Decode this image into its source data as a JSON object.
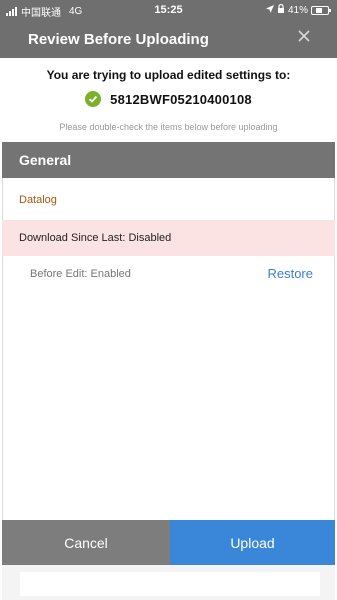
{
  "status_bar": {
    "carrier": "中国联通",
    "network": "4G",
    "time": "15:25",
    "battery": "41%",
    "battery_level": 0.41,
    "icons": [
      "signal-icon",
      "location-arrow-icon",
      "lock-rotation-icon",
      "battery-icon"
    ]
  },
  "header": {
    "title": "Review Before Uploading",
    "close_icon": "close-icon"
  },
  "info": {
    "title": "You are trying to upload edited settings to:",
    "device_id": "5812BWF05210400108",
    "device_status_icon": "check-circle-icon",
    "hint": "Please double-check the items below before uploading"
  },
  "section": {
    "title": "General",
    "group": "Datalog",
    "change": "Download Since Last: Disabled",
    "before": "Before Edit: Enabled",
    "restore_label": "Restore"
  },
  "actions": {
    "cancel_label": "Cancel",
    "upload_label": "Upload"
  },
  "colors": {
    "header_bg": "#6f6f6f",
    "section_bg": "#747474",
    "group_label": "#a4580e",
    "change_row_bg": "#fbe3e3",
    "restore_link": "#3a7fd5",
    "cancel_bg": "#7d7d7d",
    "upload_bg": "#3a86d9",
    "check": "#7bb02b"
  }
}
